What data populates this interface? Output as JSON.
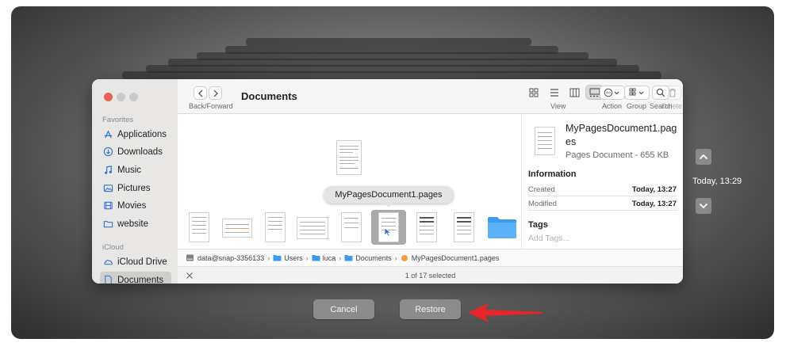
{
  "sidebar": {
    "favorites_heading": "Favorites",
    "favorites": [
      {
        "label": "Applications",
        "icon": "applications-icon"
      },
      {
        "label": "Downloads",
        "icon": "downloads-icon"
      },
      {
        "label": "Music",
        "icon": "music-icon"
      },
      {
        "label": "Pictures",
        "icon": "pictures-icon"
      },
      {
        "label": "Movies",
        "icon": "movies-icon"
      },
      {
        "label": "website",
        "icon": "folder-icon"
      }
    ],
    "icloud_heading": "iCloud",
    "icloud": [
      {
        "label": "iCloud Drive",
        "icon": "cloud-icon"
      },
      {
        "label": "Documents",
        "icon": "document-icon",
        "selected": true
      }
    ]
  },
  "toolbar": {
    "title": "Documents",
    "back_forward_label": "Back/Forward",
    "view_label": "View",
    "group_label": "Group",
    "delete_label": "Delete",
    "action_label": "Action",
    "search_label": "Search"
  },
  "tooltip": {
    "text": "MyPagesDocument1.pages"
  },
  "preview": {
    "filename": "MyPagesDocument1.pages",
    "kind_size": "Pages Document - 655 KB",
    "information_heading": "Information",
    "created_label": "Created",
    "created_value": "Today, 13:27",
    "modified_label": "Modified",
    "modified_value": "Today, 13:27",
    "tags_heading": "Tags",
    "tags_placeholder": "Add Tags..."
  },
  "pathbar": {
    "segments": [
      "data@snap-3356133",
      "Users",
      "luca",
      "Documents",
      "MyPagesDocument1.pages"
    ],
    "separator": "›"
  },
  "status": {
    "text": "1 of 17 selected"
  },
  "timemachine": {
    "timestamp": "Today, 13:29"
  },
  "buttons": {
    "cancel": "Cancel",
    "restore": "Restore"
  },
  "colors": {
    "traffic_red": "#ec5f57",
    "traffic_gray": "#c9c9c9",
    "accent_blue": "#3a8ee6",
    "arrow_red": "#e8262a"
  }
}
